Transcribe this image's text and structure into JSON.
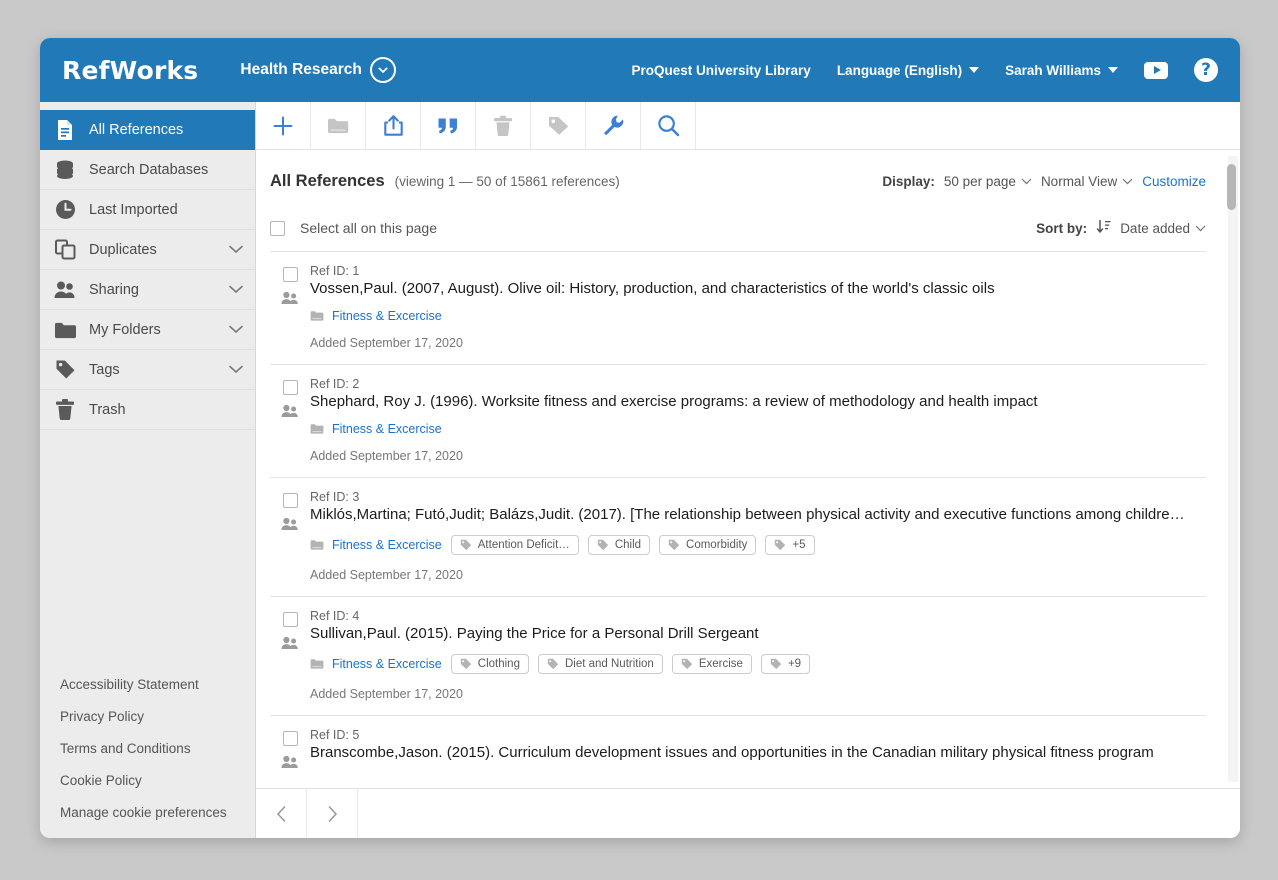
{
  "header": {
    "brand": "RefWorks",
    "project": "Health Research",
    "institution": "ProQuest University Library",
    "language": "Language (English)",
    "user": "Sarah Williams",
    "youtube_icon": "youtube-icon",
    "help_icon": "help-icon",
    "accent": "#2179b8"
  },
  "sidebar": {
    "items": [
      {
        "label": "All References",
        "icon": "document-icon",
        "active": true,
        "expandable": false
      },
      {
        "label": "Search Databases",
        "icon": "database-icon",
        "active": false,
        "expandable": false
      },
      {
        "label": "Last Imported",
        "icon": "clock-icon",
        "active": false,
        "expandable": false
      },
      {
        "label": "Duplicates",
        "icon": "copy-icon",
        "active": false,
        "expandable": true
      },
      {
        "label": "Sharing",
        "icon": "people-icon",
        "active": false,
        "expandable": true
      },
      {
        "label": "My Folders",
        "icon": "folder-icon",
        "active": false,
        "expandable": true
      },
      {
        "label": "Tags",
        "icon": "tag-icon",
        "active": false,
        "expandable": true
      },
      {
        "label": "Trash",
        "icon": "trash-icon",
        "active": false,
        "expandable": false
      }
    ],
    "footer_links": [
      "Accessibility Statement",
      "Privacy Policy",
      "Terms and Conditions",
      "Cookie Policy",
      "Manage cookie preferences"
    ]
  },
  "toolbar": {
    "buttons": [
      {
        "name": "add-icon",
        "enabled": true
      },
      {
        "name": "folder-icon",
        "enabled": false
      },
      {
        "name": "share-icon",
        "enabled": true
      },
      {
        "name": "quote-icon",
        "enabled": true
      },
      {
        "name": "trash-icon",
        "enabled": false
      },
      {
        "name": "tag-icon",
        "enabled": false
      },
      {
        "name": "wrench-icon",
        "enabled": true
      },
      {
        "name": "search-icon",
        "enabled": true
      }
    ]
  },
  "list": {
    "title": "All References",
    "count_text": "(viewing 1 — 50 of 15861 references)",
    "display_label": "Display:",
    "per_page": "50 per page",
    "view_mode": "Normal View",
    "customize": "Customize",
    "select_all": "Select all on this page",
    "sort_label": "Sort by:",
    "sort_value": "Date added"
  },
  "references": [
    {
      "ref_id": "Ref ID: 1",
      "title": "Vossen,Paul. (2007, August). Olive oil: History, production, and characteristics of the world's classic oils",
      "folder": "Fitness & Excercise",
      "tags": [],
      "added": "Added September 17, 2020"
    },
    {
      "ref_id": "Ref ID: 2",
      "title": "Shephard, Roy J. (1996). Worksite fitness and exercise programs: a review of methodology and health impact",
      "folder": "Fitness & Excercise",
      "tags": [],
      "added": "Added September 17, 2020"
    },
    {
      "ref_id": "Ref ID: 3",
      "title": "Miklós,Martina; Futó,Judit; Balázs,Judit. (2017). [The relationship between physical activity and executive functions among childre…",
      "folder": "Fitness & Excercise",
      "tags": [
        "Attention Deficit…",
        "Child",
        "Comorbidity",
        "+5"
      ],
      "added": "Added September 17, 2020"
    },
    {
      "ref_id": "Ref ID: 4",
      "title": "Sullivan,Paul. (2015). Paying the Price for a Personal Drill Sergeant",
      "folder": "Fitness & Excercise",
      "tags": [
        "Clothing",
        "Diet and Nutrition",
        "Exercise",
        "+9"
      ],
      "added": "Added September 17, 2020"
    },
    {
      "ref_id": "Ref ID: 5",
      "title": "Branscombe,Jason. (2015). Curriculum development issues and opportunities in the Canadian military physical fitness program",
      "folder": "",
      "tags": [],
      "added": ""
    }
  ],
  "pager": {
    "prev_icon": "chevron-left-icon",
    "next_icon": "chevron-right-icon"
  }
}
